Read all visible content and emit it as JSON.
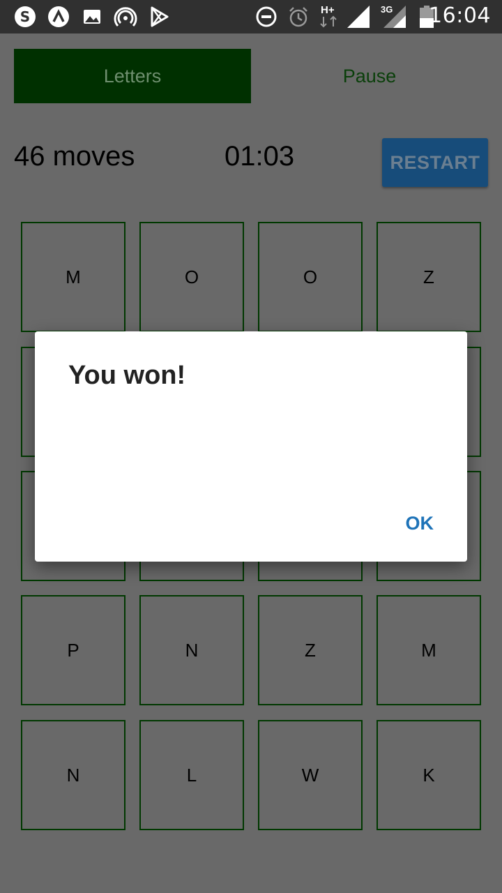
{
  "status_bar": {
    "time": "16:04",
    "network_h": "H+",
    "network_3g": "3G",
    "icons": [
      "skype-icon",
      "expo-icon",
      "image-icon",
      "hotspot-icon",
      "play-store-icon",
      "dnd-icon",
      "alarm-icon",
      "signal-icon",
      "signal-3g-icon",
      "battery-icon"
    ]
  },
  "tabs": {
    "letters": "Letters",
    "pause": "Pause"
  },
  "stats": {
    "moves": "46 moves",
    "timer": "01:03",
    "restart_label": "RESTART"
  },
  "grid": {
    "rows": [
      [
        "M",
        "O",
        "O",
        "Z"
      ],
      [
        "",
        "",
        "",
        ""
      ],
      [
        "",
        "",
        "",
        ""
      ],
      [
        "P",
        "N",
        "Z",
        "M"
      ],
      [
        "N",
        "L",
        "W",
        "K"
      ]
    ]
  },
  "dialog": {
    "title": "You won!",
    "ok_label": "OK"
  },
  "colors": {
    "background": "#696969",
    "active_tab": "#003000",
    "cell_border": "#003800",
    "restart": "#174c7a",
    "ok_text": "#1e73b8"
  }
}
